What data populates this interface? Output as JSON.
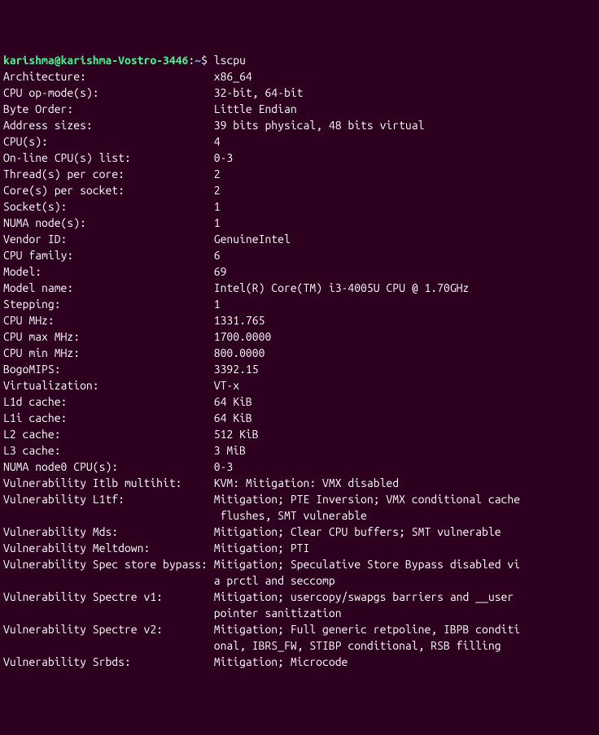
{
  "prompt": {
    "user": "karishma",
    "at": "@",
    "host": "karishma-Vostro-3446",
    "colon": ":",
    "path": "~",
    "dollar": "$ ",
    "command": "lscpu"
  },
  "label_width": 33,
  "lines": [
    {
      "label": "Architecture:",
      "value": "x86_64"
    },
    {
      "label": "CPU op-mode(s):",
      "value": "32-bit, 64-bit"
    },
    {
      "label": "Byte Order:",
      "value": "Little Endian"
    },
    {
      "label": "Address sizes:",
      "value": "39 bits physical, 48 bits virtual"
    },
    {
      "label": "CPU(s):",
      "value": "4"
    },
    {
      "label": "On-line CPU(s) list:",
      "value": "0-3"
    },
    {
      "label": "Thread(s) per core:",
      "value": "2"
    },
    {
      "label": "Core(s) per socket:",
      "value": "2"
    },
    {
      "label": "Socket(s):",
      "value": "1"
    },
    {
      "label": "NUMA node(s):",
      "value": "1"
    },
    {
      "label": "Vendor ID:",
      "value": "GenuineIntel"
    },
    {
      "label": "CPU family:",
      "value": "6"
    },
    {
      "label": "Model:",
      "value": "69"
    },
    {
      "label": "Model name:",
      "value": "Intel(R) Core(TM) i3-4005U CPU @ 1.70GHz"
    },
    {
      "label": "Stepping:",
      "value": "1"
    },
    {
      "label": "CPU MHz:",
      "value": "1331.765"
    },
    {
      "label": "CPU max MHz:",
      "value": "1700.0000"
    },
    {
      "label": "CPU min MHz:",
      "value": "800.0000"
    },
    {
      "label": "BogoMIPS:",
      "value": "3392.15"
    },
    {
      "label": "Virtualization:",
      "value": "VT-x"
    },
    {
      "label": "L1d cache:",
      "value": "64 KiB"
    },
    {
      "label": "L1i cache:",
      "value": "64 KiB"
    },
    {
      "label": "L2 cache:",
      "value": "512 KiB"
    },
    {
      "label": "L3 cache:",
      "value": "3 MiB"
    },
    {
      "label": "NUMA node0 CPU(s):",
      "value": "0-3"
    },
    {
      "label": "Vulnerability Itlb multihit:",
      "value": "KVM: Mitigation: VMX disabled"
    },
    {
      "label": "Vulnerability L1tf:",
      "value": "Mitigation; PTE Inversion; VMX conditional cache flushes, SMT vulnerable"
    },
    {
      "label": "Vulnerability Mds:",
      "value": "Mitigation; Clear CPU buffers; SMT vulnerable"
    },
    {
      "label": "Vulnerability Meltdown:",
      "value": "Mitigation; PTI"
    },
    {
      "label": "Vulnerability Spec store bypass:",
      "value": "Mitigation; Speculative Store Bypass disabled via prctl and seccomp"
    },
    {
      "label": "Vulnerability Spectre v1:",
      "value": "Mitigation; usercopy/swapgs barriers and __user pointer sanitization"
    },
    {
      "label": "Vulnerability Spectre v2:",
      "value": "Mitigation; Full generic retpoline, IBPB conditional, IBRS_FW, STIBP conditional, RSB filling"
    },
    {
      "label": "Vulnerability Srbds:",
      "value": "Mitigation; Microcode"
    }
  ],
  "wrap_width": 81
}
